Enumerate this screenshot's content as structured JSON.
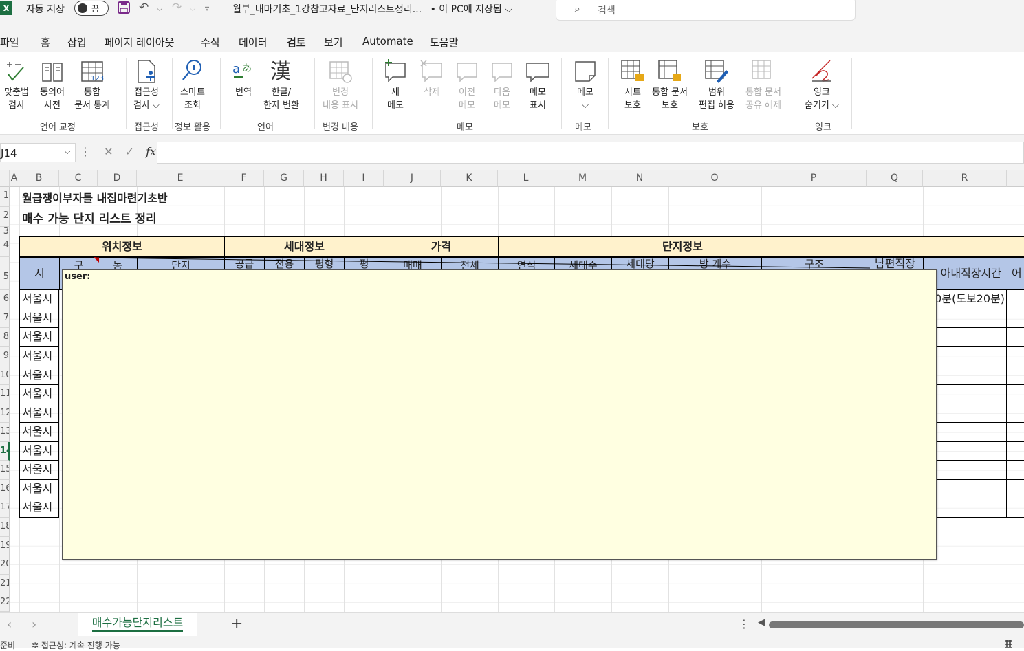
{
  "titlebar": {
    "app_icon": "X",
    "autosave_label": "자동 저장",
    "autosave_state": "끔",
    "doc_title": "월부_내마기초_1강참고자료_단지리스트정리...",
    "save_location": "• 이 PC에 저장됨 ⌵",
    "search_placeholder": "검색"
  },
  "menu_tabs": [
    "파일",
    "홈",
    "삽입",
    "페이지 레이아웃",
    "수식",
    "데이터",
    "검토",
    "보기",
    "Automate",
    "도움말"
  ],
  "ribbon": {
    "buttons": [
      {
        "label1": "맞춤법",
        "label2": "검사",
        "icon": "spellcheck-icon"
      },
      {
        "label1": "동의어",
        "label2": "사전",
        "icon": "thesaurus-icon"
      },
      {
        "label1": "통합",
        "label2": "문서 통계",
        "icon": "workbook-statistics-icon"
      },
      {
        "label1": "접근성",
        "label2": "검사 ⌵",
        "icon": "accessibility-icon"
      },
      {
        "label1": "스마트",
        "label2": "조회",
        "icon": "smart-lookup-icon"
      },
      {
        "label1": "번역",
        "label2": "",
        "icon": "translate-icon"
      },
      {
        "label1": "한글/",
        "label2": "한자 변환",
        "icon": "hanja-icon"
      },
      {
        "label1": "변경",
        "label2": "내용 표시",
        "icon": "show-changes-icon"
      },
      {
        "label1": "새",
        "label2": "메모",
        "icon": "new-comment-icon"
      },
      {
        "label1": "삭제",
        "label2": "",
        "icon": "delete-comment-icon"
      },
      {
        "label1": "이전",
        "label2": "메모",
        "icon": "previous-comment-icon"
      },
      {
        "label1": "다음",
        "label2": "메모",
        "icon": "next-comment-icon"
      },
      {
        "label1": "메모",
        "label2": "표시",
        "icon": "show-comments-icon"
      },
      {
        "label1": "메모",
        "label2": "⌵",
        "icon": "notes-icon"
      },
      {
        "label1": "시트",
        "label2": "보호",
        "icon": "protect-sheet-icon"
      },
      {
        "label1": "통합 문서",
        "label2": "보호",
        "icon": "protect-workbook-icon"
      },
      {
        "label1": "범위",
        "label2": "편집 허용",
        "icon": "allow-edit-ranges-icon"
      },
      {
        "label1": "통합 문서",
        "label2": "공유 해제",
        "icon": "unshare-workbook-icon"
      },
      {
        "label1": "잉크",
        "label2": "숨기기 ⌵",
        "icon": "hide-ink-icon"
      }
    ],
    "groups": [
      "언어 교정",
      "접근성",
      "정보 활용",
      "언어",
      "변경 내용",
      "메모",
      "메모",
      "보호",
      "잉크"
    ]
  },
  "formula_bar": {
    "name_box": "J14",
    "fx": "fx",
    "value": ""
  },
  "columns": [
    "A",
    "B",
    "C",
    "D",
    "E",
    "F",
    "G",
    "H",
    "I",
    "J",
    "K",
    "L",
    "M",
    "N",
    "O",
    "P",
    "Q",
    "R"
  ],
  "rows": [
    "1",
    "2",
    "3",
    "4",
    "5",
    "6",
    "7",
    "8",
    "9",
    "10",
    "11",
    "12",
    "13",
    "14",
    "15",
    "16",
    "17",
    "18",
    "19",
    "20",
    "21",
    "22"
  ],
  "sheet": {
    "title1": "월급쟁이부자들 내집마련기초반",
    "title2": "매수 가능 단지 리스트 정리",
    "group_headers": [
      "위치정보",
      "세대정보",
      "가격",
      "단지정보"
    ],
    "sub_headers": {
      "si": "시",
      "gu": "구",
      "dong": "동",
      "danji": "단지",
      "supply": "공급",
      "exclusive": "전용",
      "pyeong": "평형",
      "pyeong2": "평",
      "sale": "매매",
      "jeonse": "전세",
      "year": "연식",
      "households": "세대수",
      "parking": "세대당",
      "rooms": "방 개수",
      "structure": "구조",
      "husband_commute": "남편직장",
      "wife_commute": "아내직장시간",
      "etc": "어"
    },
    "city_values": [
      "서울시",
      "서울시",
      "서울시",
      "서울시",
      "서울시",
      "서울시",
      "서울시",
      "서울시",
      "서울시",
      "서울시",
      "서울시",
      "서울시"
    ],
    "r_first_value": "0분(도보20분)"
  },
  "comment": {
    "author": "user:"
  },
  "sheet_tabs": {
    "active": "매수가능단지리스트",
    "add": "+"
  },
  "status": {
    "left": "준비",
    "accessibility": "접근성: 계속 진행 가능"
  }
}
